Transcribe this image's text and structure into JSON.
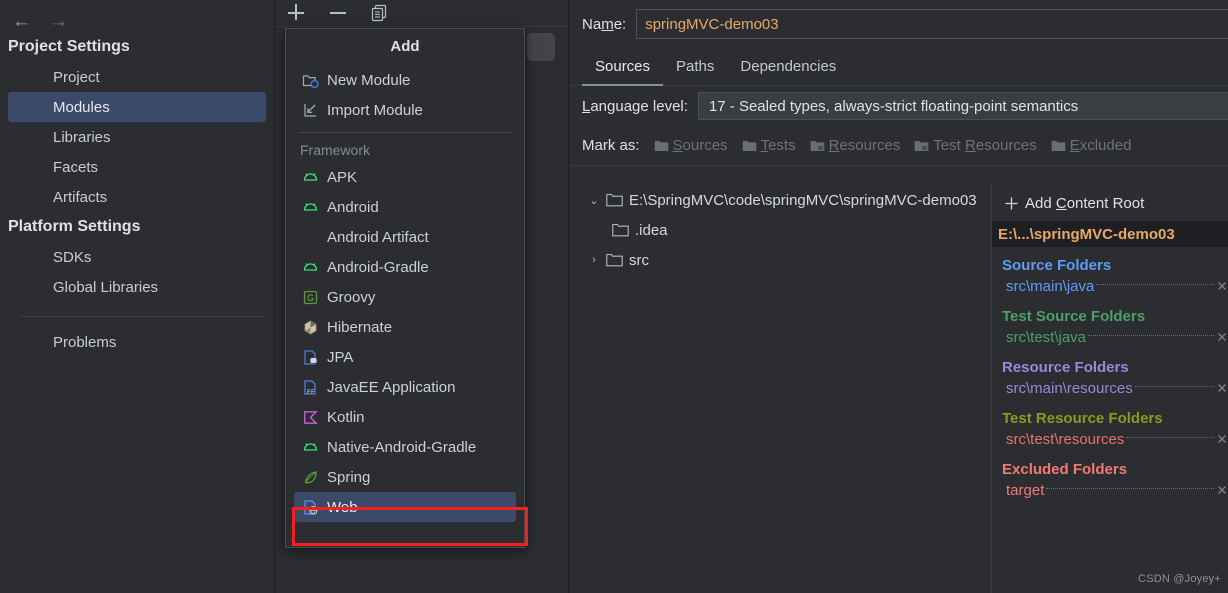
{
  "sidebar": {
    "back_arrow": "←",
    "forward_arrow": "→",
    "groups": [
      {
        "title": "Project Settings",
        "items": [
          {
            "label": "Project",
            "selected": false
          },
          {
            "label": "Modules",
            "selected": true
          },
          {
            "label": "Libraries",
            "selected": false
          },
          {
            "label": "Facets",
            "selected": false
          },
          {
            "label": "Artifacts",
            "selected": false
          }
        ]
      },
      {
        "title": "Platform Settings",
        "items": [
          {
            "label": "SDKs",
            "selected": false
          },
          {
            "label": "Global Libraries",
            "selected": false
          }
        ]
      }
    ],
    "problems": "Problems"
  },
  "toolbar": {
    "add_icon": "plus-icon",
    "remove_icon": "minus-icon",
    "copy_icon": "copy-icon"
  },
  "add_popup": {
    "title": "Add",
    "top_items": [
      {
        "label": "New Module",
        "icon": "new-module-icon"
      },
      {
        "label": "Import Module",
        "icon": "import-module-icon"
      }
    ],
    "framework_header": "Framework",
    "frameworks": [
      {
        "label": "APK",
        "icon": "android-icon"
      },
      {
        "label": "Android",
        "icon": "android-icon"
      },
      {
        "label": "Android Artifact",
        "icon": "none"
      },
      {
        "label": "Android-Gradle",
        "icon": "android-icon"
      },
      {
        "label": "Groovy",
        "icon": "groovy-icon"
      },
      {
        "label": "Hibernate",
        "icon": "hibernate-icon"
      },
      {
        "label": "JPA",
        "icon": "jpa-icon"
      },
      {
        "label": "JavaEE Application",
        "icon": "javaee-icon"
      },
      {
        "label": "Kotlin",
        "icon": "kotlin-icon"
      },
      {
        "label": "Native-Android-Gradle",
        "icon": "android-icon"
      },
      {
        "label": "Spring",
        "icon": "spring-icon"
      },
      {
        "label": "Web",
        "icon": "web-icon",
        "selected": true
      }
    ]
  },
  "module": {
    "name_label_pre": "Na",
    "name_label_mnemonic": "m",
    "name_label_post": "e:",
    "name_value": "springMVC-demo03",
    "tabs": [
      {
        "label": "Sources",
        "active": true
      },
      {
        "label": "Paths",
        "active": false
      },
      {
        "label": "Dependencies",
        "active": false
      }
    ],
    "language_level_label_mnemonic": "L",
    "language_level_label_rest": "anguage level:",
    "language_level_value": "17 - Sealed types, always-strict floating-point semantics",
    "mark_as_label": "Mark as:",
    "mark_as_options": [
      {
        "pre": "",
        "mnemonic": "S",
        "post": "ources"
      },
      {
        "pre": "",
        "mnemonic": "T",
        "post": "ests"
      },
      {
        "pre": "",
        "mnemonic": "R",
        "post": "esources"
      },
      {
        "pre": "Test ",
        "mnemonic": "R",
        "post": "esources"
      },
      {
        "pre": "",
        "mnemonic": "E",
        "post": "xcluded"
      }
    ]
  },
  "tree": {
    "rows": [
      {
        "label": "E:\\SpringMVC\\code\\springMVC\\springMVC-demo03",
        "indent": 0,
        "twisty": "⌄",
        "expanded": true
      },
      {
        "label": ".idea",
        "indent": 1,
        "twisty": ""
      },
      {
        "label": "src",
        "indent": 1,
        "twisty": "›"
      }
    ]
  },
  "content_roots": {
    "add_label_pre": "Add ",
    "add_label_mnemonic": "C",
    "add_label_post": "ontent Root",
    "root_path": "E:\\...\\springMVC-demo03",
    "sections": [
      {
        "title": "Source Folders",
        "color": "#5f9bf5",
        "item_color": "#5f9bf5",
        "items": [
          "src\\main\\java"
        ]
      },
      {
        "title": "Test Source Folders",
        "color": "#4c9f68",
        "item_color": "#4c9f68",
        "items": [
          "src\\test\\java"
        ]
      },
      {
        "title": "Resource Folders",
        "color": "#9a88d8",
        "item_color": "#9a88d8",
        "items": [
          "src\\main\\resources"
        ]
      },
      {
        "title": "Test Resource Folders",
        "color": "#8a9a21",
        "item_color": "#e8726a",
        "items": [
          "src\\test\\resources"
        ]
      },
      {
        "title": "Excluded Folders",
        "color": "#f07b72",
        "item_color": "#f07b72",
        "items": [
          "target"
        ]
      }
    ]
  },
  "watermark": "CSDN @Joyey+",
  "colors": {
    "background": "#2b2d30",
    "selection_blue": "#3b4a69",
    "annotation_red": "#f61f1f",
    "value_orange": "#e8a868"
  }
}
